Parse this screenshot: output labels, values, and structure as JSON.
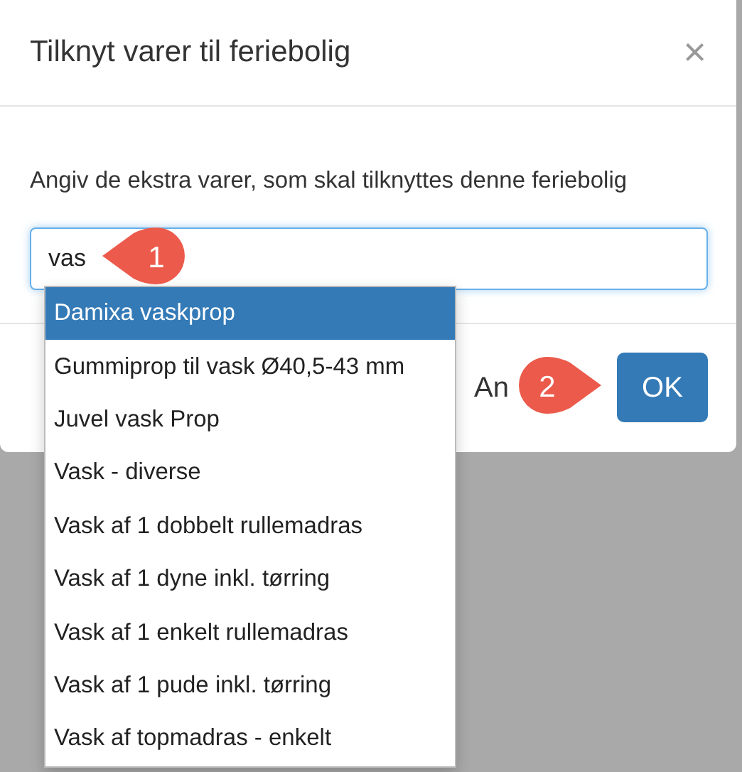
{
  "dialog": {
    "title": "Tilknyt varer til feriebolig",
    "close": "×",
    "prompt": "Angiv de ekstra varer, som skal tilknyttes denne feriebolig",
    "search": {
      "value": "vas"
    },
    "suggestions": [
      {
        "label": "Damixa vaskprop",
        "selected": true
      },
      {
        "label": "Gummiprop til vask Ø40,5-43 mm",
        "selected": false
      },
      {
        "label": "Juvel vask Prop",
        "selected": false
      },
      {
        "label": "Vask - diverse",
        "selected": false
      },
      {
        "label": "Vask af 1 dobbelt rullemadras",
        "selected": false
      },
      {
        "label": "Vask af 1 dyne inkl. tørring",
        "selected": false
      },
      {
        "label": "Vask af 1 enkelt rullemadras",
        "selected": false
      },
      {
        "label": "Vask af 1 pude inkl. tørring",
        "selected": false
      },
      {
        "label": "Vask af topmadras - enkelt",
        "selected": false
      }
    ],
    "buttons": [
      {
        "kind": "secondary",
        "label": "An"
      },
      {
        "kind": "primary",
        "label": "OK"
      }
    ]
  },
  "markers": [
    {
      "kind": "point-left",
      "number": "1"
    },
    {
      "kind": "point-right",
      "number": "2"
    }
  ]
}
